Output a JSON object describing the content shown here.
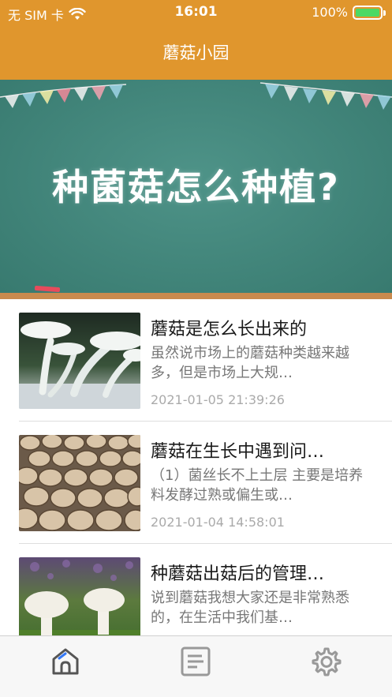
{
  "status_bar": {
    "carrier": "无 SIM 卡",
    "time": "16:01",
    "battery": "100%",
    "battery_level": 1.0,
    "battery_color": "#4cd964"
  },
  "nav": {
    "title": "蘑菇小园"
  },
  "banner": {
    "text": "种菌菇怎么种植?"
  },
  "articles": [
    {
      "title": "蘑菇是怎么长出来的",
      "summary": "虽然说市场上的蘑菇种类越来越多，但是市场上大规…",
      "date": "2021-01-05 21:39:26"
    },
    {
      "title": "蘑菇在生长中遇到问…",
      "summary": "（1）菌丝长不上土层 主要是培养料发酵过熟或偏生或…",
      "date": "2021-01-04 14:58:01"
    },
    {
      "title": "种蘑菇出菇后的管理…",
      "summary": "说到蘑菇我想大家还是非常熟悉的，在生活中我们基…",
      "date": ""
    }
  ],
  "tabs": [
    {
      "icon": "home-icon",
      "active": true
    },
    {
      "icon": "document-list-icon",
      "active": false
    },
    {
      "icon": "gear-icon",
      "active": false
    }
  ],
  "colors": {
    "brand": "#e0962d",
    "board": "#3f8a7e",
    "tab_active": "#555555",
    "tab_accent": "#3478f6"
  }
}
